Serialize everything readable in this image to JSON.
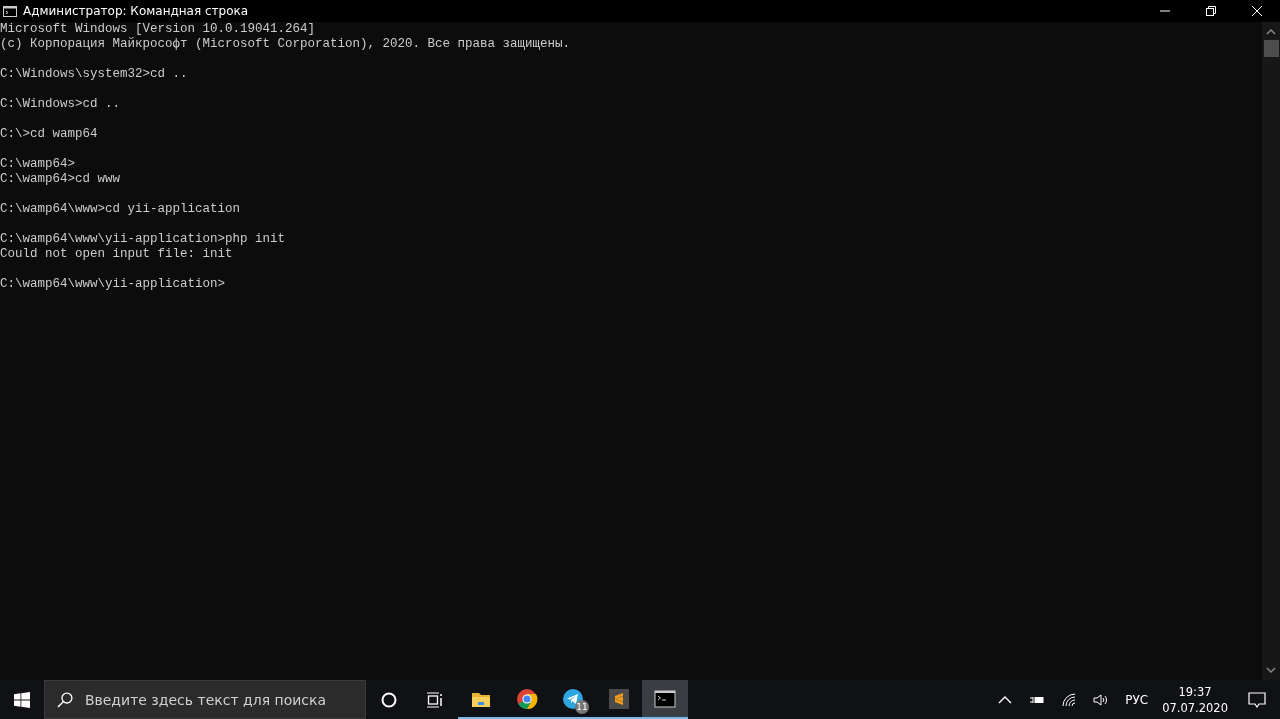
{
  "window": {
    "title": "Администратор: Командная строка"
  },
  "console": {
    "blocks": [
      [
        "Microsoft Windows [Version 10.0.19041.264]",
        "(c) Корпорация Майкрософт (Microsoft Corporation), 2020. Все права защищены."
      ],
      [
        "C:\\Windows\\system32>cd .."
      ],
      [
        "C:\\Windows>cd .."
      ],
      [
        "C:\\>cd wamp64"
      ],
      [
        "C:\\wamp64>",
        "C:\\wamp64>cd www"
      ],
      [
        "C:\\wamp64\\www>cd yii-application"
      ],
      [
        "C:\\wamp64\\www\\yii-application>php init",
        "Could not open input file: init"
      ],
      [
        "C:\\wamp64\\www\\yii-application>"
      ]
    ]
  },
  "taskbar": {
    "search": {
      "placeholder": "Введите здесь текст для поиска"
    },
    "apps": [
      {
        "kind": "folder",
        "selected": false
      },
      {
        "kind": "chrome",
        "selected": false
      },
      {
        "kind": "telegram",
        "selected": false,
        "badge": "11"
      },
      {
        "kind": "sublime",
        "selected": false
      },
      {
        "kind": "cmd",
        "selected": true
      }
    ],
    "tray": {
      "language": "РУС",
      "time": "19:37",
      "date": "07.07.2020"
    }
  }
}
